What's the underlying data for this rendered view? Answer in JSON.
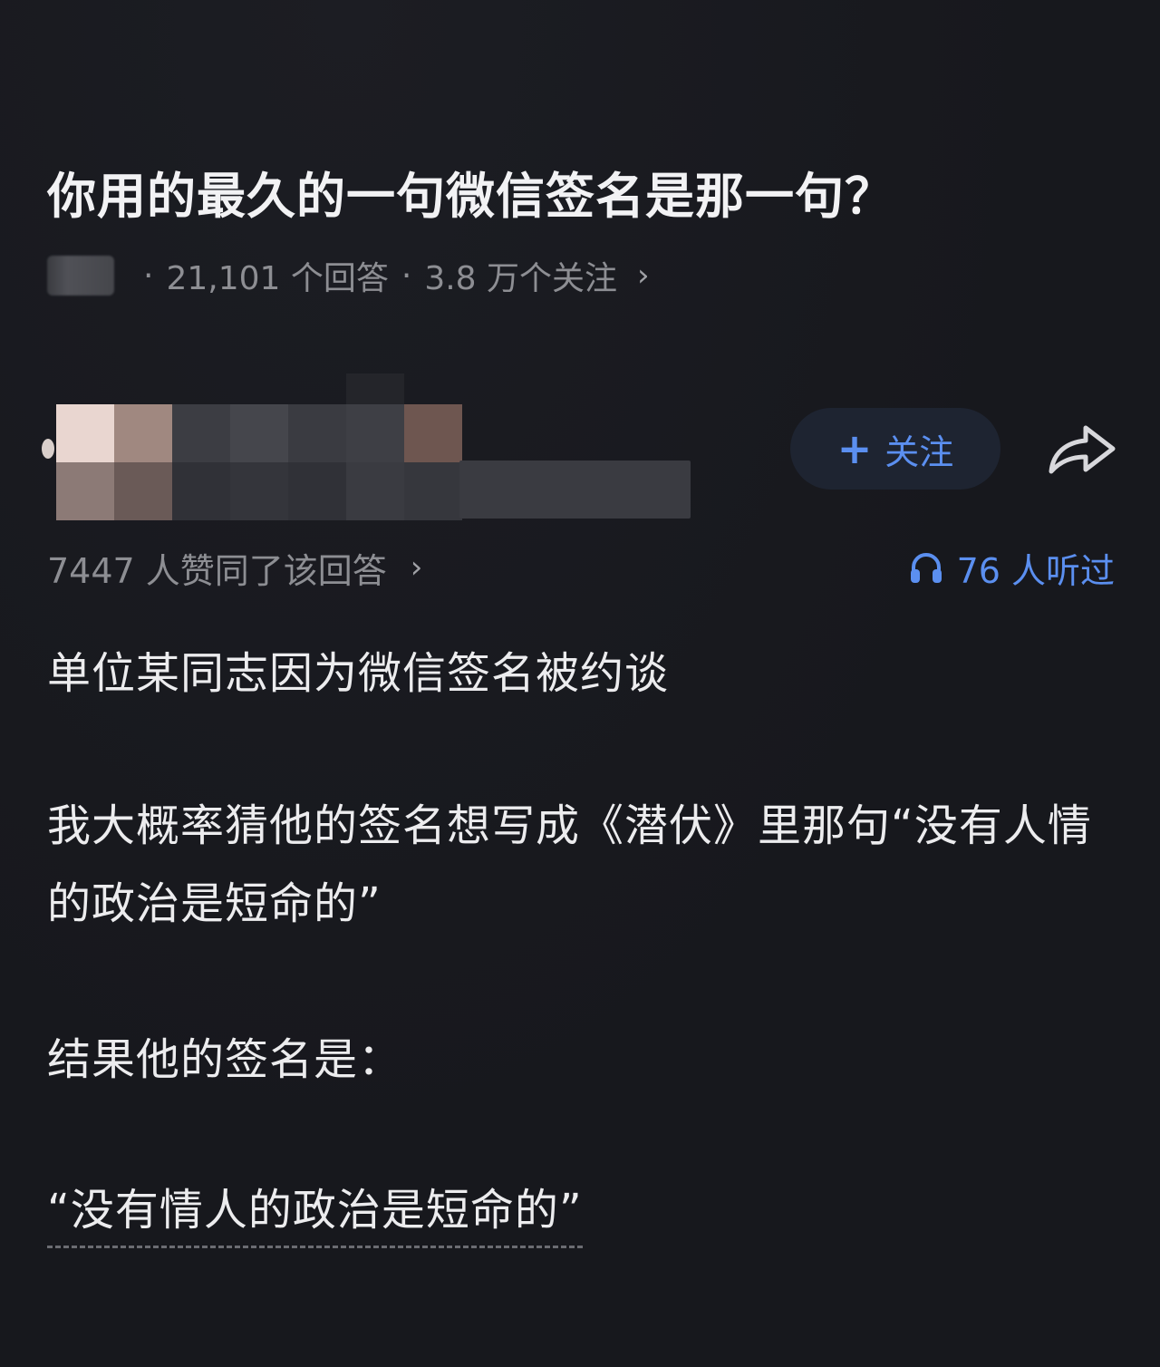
{
  "question": {
    "title": "你用的最久的一句微信签名是那一句？",
    "answers_count": "21,101 个回答",
    "followers_count": "3.8 万个关注",
    "separator": "·",
    "chevron": "›"
  },
  "author": {
    "follow_plus": "+",
    "follow_label": "关注"
  },
  "stats": {
    "likes": "7447 人赞同了该回答",
    "chevron": "›",
    "listened": "76 人听过"
  },
  "answer": {
    "p1": "单位某同志因为微信签名被约谈",
    "p2": "我大概率猜他的签名想写成《潜伏》里那句“没有人情的政治是短命的”",
    "p3": "结果他的签名是：",
    "p4": "“没有情人的政治是短命的”"
  },
  "colors": {
    "background": "#17181d",
    "accent": "#5b8ff0",
    "text": "#ececee",
    "muted": "#8d8e93"
  },
  "icons": {
    "share": "share-icon",
    "headphone": "headphone-icon",
    "chevron": "chevron-right-icon"
  }
}
